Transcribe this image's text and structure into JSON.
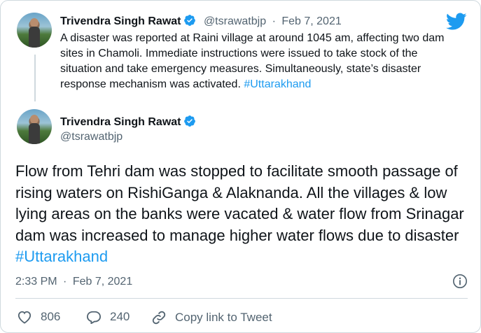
{
  "tweet1": {
    "name": "Trivendra Singh Rawat",
    "handle": "@tsrawatbjp",
    "separator": "·",
    "date": "Feb 7, 2021",
    "text": "A disaster was reported at Raini village at around 1045 am, affecting two dam sites in Chamoli. Immediate instructions were issued to take stock of the situation and take emergency measures. Simultaneously, state’s disaster response mechanism was activated. ",
    "hashtag": "#Uttarakhand"
  },
  "tweet2": {
    "name": "Trivendra Singh Rawat",
    "handle": "@tsrawatbjp",
    "text": "Flow from Tehri dam was stopped to facilitate smooth passage of rising waters on RishiGanga & Alaknanda. All the villages & low lying areas on the banks were vacated & water flow from Srinagar dam was increased to manage higher water flows due to disaster ",
    "hashtag": "#Uttarakhand",
    "time": "2:33 PM",
    "separator": "·",
    "date": "Feb 7, 2021"
  },
  "actions": {
    "likes": "806",
    "replies": "240",
    "copy_link": "Copy link to Tweet"
  },
  "icons": [
    "verified-badge-icon",
    "twitter-bird-icon",
    "info-icon",
    "heart-icon",
    "reply-icon",
    "link-icon"
  ],
  "colors": {
    "accent": "#1d9bf0",
    "text": "#0f1419",
    "muted": "#536471",
    "border": "#cfd9de"
  }
}
